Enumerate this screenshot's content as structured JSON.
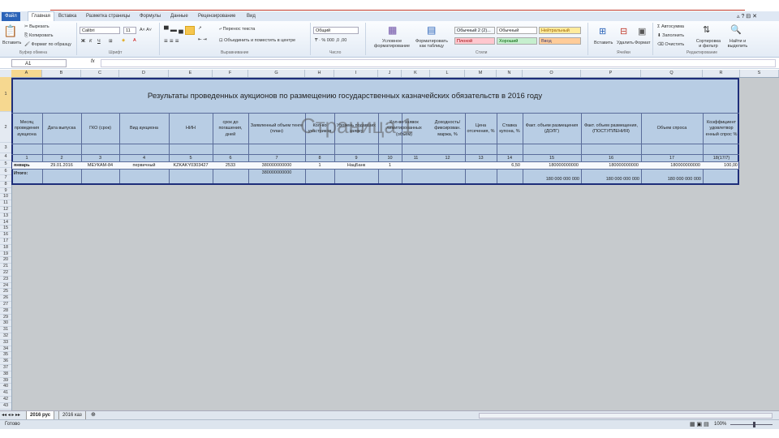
{
  "ribbon_tabs": [
    "Файл",
    "Главная",
    "Вставка",
    "Разметка страницы",
    "Формулы",
    "Данные",
    "Рецензирование",
    "Вид"
  ],
  "clipboard": {
    "paste": "Вставить",
    "cut": "Вырезать",
    "copy": "Копировать",
    "format": "Формат по образцу",
    "group": "Буфер обмена"
  },
  "font": {
    "name": "Calibri",
    "size": "11",
    "group": "Шрифт"
  },
  "alignment": {
    "wrap": "Перенос текста",
    "merge": "Объединить и поместить в центре",
    "group": "Выравнивание"
  },
  "number": {
    "format": "Общий",
    "group": "Число"
  },
  "styles": {
    "cond": "Условное форматирование",
    "table": "Форматировать как таблицу",
    "group": "Стили",
    "swatches": [
      {
        "label": "Обычный 2 (2)...",
        "color": "#ffffff"
      },
      {
        "label": "Обычный",
        "color": "#ffffff"
      },
      {
        "label": "Нейтральный",
        "color": "#ffeb9c"
      },
      {
        "label": "Плохой",
        "color": "#ffc7ce"
      },
      {
        "label": "Хороший",
        "color": "#c6efce"
      },
      {
        "label": "Ввод",
        "color": "#ffcc99"
      }
    ]
  },
  "cells": {
    "insert": "Вставить",
    "delete": "Удалить",
    "format": "Формат",
    "group": "Ячейки"
  },
  "editing": {
    "autosum": "Автосумма",
    "fill": "Заполнить",
    "clear": "Очистить",
    "sort": "Сортировка и фильтр",
    "find": "Найти и выделить",
    "group": "Редактирование"
  },
  "namebox": "A1",
  "fx": "fx",
  "columns": [
    "A",
    "B",
    "C",
    "D",
    "E",
    "F",
    "G",
    "H",
    "I",
    "J",
    "K",
    "L",
    "M",
    "N",
    "O",
    "P",
    "Q",
    "R",
    "S"
  ],
  "rows": [
    "1",
    "2",
    "3",
    "4",
    "5",
    "6",
    "7",
    "8",
    "9",
    "10",
    "11",
    "12",
    "13",
    "14",
    "15",
    "16",
    "17",
    "18",
    "19",
    "20",
    "21",
    "22",
    "23",
    "24",
    "25",
    "26",
    "27",
    "28",
    "29",
    "30",
    "31",
    "32",
    "33",
    "34",
    "35",
    "36",
    "37",
    "38",
    "39",
    "40",
    "41",
    "42",
    "43",
    "44",
    "45",
    "46",
    "47",
    "48",
    "49",
    "50",
    "51",
    "52",
    "53"
  ],
  "table": {
    "title": "Результаты проведенных аукционов по размещению государственных казначейских обязательств в 2016 году",
    "headers": [
      "Месяц проведения аукциона",
      "Дата выпуска",
      "ГКО (срок)",
      "Вид аукциона",
      "НИН",
      "срок до погашения, дней",
      "Заявленный объем тенге (план)",
      "Кол-во участников",
      "Уровень подавших заявку",
      "Кол-во заявок лимитированных (объем)",
      "рыночных",
      "Доходность/ фиксирован. маржа, %",
      "Цена отсечения, %",
      "Ставка купона, %",
      "Факт. объем размещения (ДОЛГ)",
      "Факт. объем размещения, (ПОСТУПЛЕНИЯ)",
      "Объем спроса",
      "Коэффициент удовлетвор енный спрос %"
    ],
    "numbers": [
      "1",
      "2",
      "3",
      "4",
      "5",
      "6",
      "7",
      "8",
      "9",
      "10",
      "11",
      "12",
      "13",
      "14",
      "15",
      "16",
      "17",
      "18(17/7)"
    ],
    "row5": [
      "январь",
      "29.01.2016",
      "МЕУКАМ-84",
      "первичный",
      "KZKAKY0303427",
      "2533",
      "380000000000",
      "1",
      "НацБанк",
      "1",
      "",
      "",
      "",
      "6,50",
      "180000000000",
      "180000000000",
      "180000000000",
      "100,00"
    ],
    "total": {
      "label": "Итого:",
      "plan": "380000000000",
      "debt": "180 000 000 000",
      "proceeds": "180 000 000 000",
      "demand": "180 000 000 000"
    }
  },
  "watermark": "Страница 1",
  "sheets": [
    "2016 рус",
    "2016 каз"
  ],
  "status": {
    "ready": "Готово",
    "zoom": "100%"
  }
}
